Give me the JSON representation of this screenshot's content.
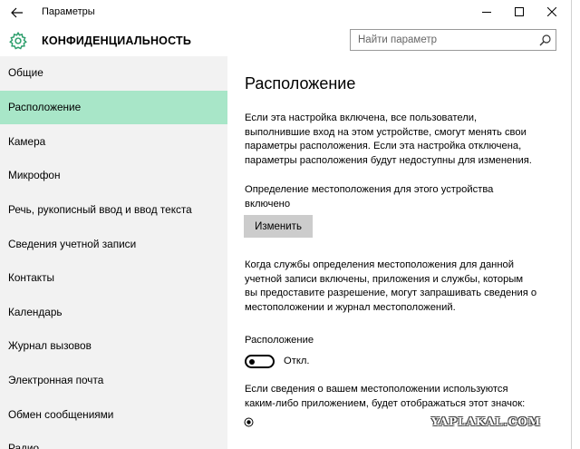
{
  "window": {
    "title": "Параметры"
  },
  "header": {
    "section_title": "КОНФИДЕНЦИАЛЬНОСТЬ",
    "search_placeholder": "Найти параметр"
  },
  "sidebar": {
    "items": [
      {
        "label": "Общие",
        "selected": false
      },
      {
        "label": "Расположение",
        "selected": true
      },
      {
        "label": "Камера",
        "selected": false
      },
      {
        "label": "Микрофон",
        "selected": false
      },
      {
        "label": "Речь, рукописный ввод и ввод текста",
        "selected": false
      },
      {
        "label": "Сведения учетной записи",
        "selected": false
      },
      {
        "label": "Контакты",
        "selected": false
      },
      {
        "label": "Календарь",
        "selected": false
      },
      {
        "label": "Журнал вызовов",
        "selected": false
      },
      {
        "label": "Электронная почта",
        "selected": false
      },
      {
        "label": "Обмен сообщениями",
        "selected": false
      },
      {
        "label": "Радио",
        "selected": false
      }
    ]
  },
  "content": {
    "title": "Расположение",
    "intro_lines": [
      "Если эта настройка включена, все пользователи,",
      "выполнившие вход на этом устройстве, смогут менять свои",
      "параметры расположения. Если эта настройка отключена,",
      "параметры расположения будут недоступны для изменения."
    ],
    "device_status_lines": [
      "Определение местоположения для этого устройства",
      "включено"
    ],
    "change_button": "Изменить",
    "services_lines": [
      "Когда службы определения местоположения для данной",
      "учетной записи включены, приложения и службы, которым",
      "вы предоставите разрешение, могут запрашивать сведения о",
      "местоположении и журнал местоположений."
    ],
    "toggle_label": "Расположение",
    "toggle_state": "Откл.",
    "toggle_on": false,
    "indicator_lines": [
      "Если сведения о вашем местоположении используются",
      "каким-либо приложением, будет отображаться этот значок:"
    ]
  },
  "watermark": "YAPLAKAL.COM",
  "colors": {
    "selected_nav": "#a8e6c8",
    "sidebar_bg": "#f2f2f2",
    "button_bg": "#cccccc"
  }
}
